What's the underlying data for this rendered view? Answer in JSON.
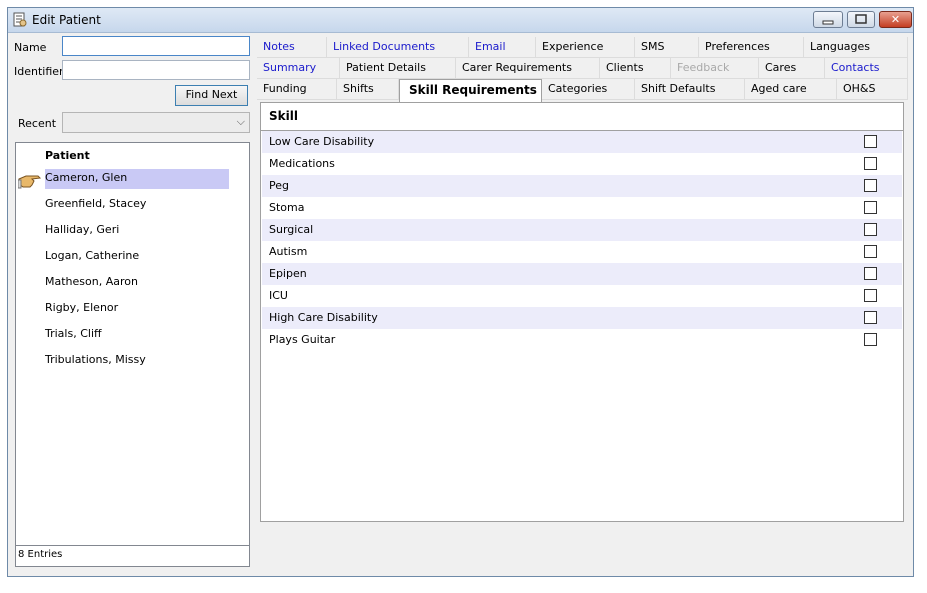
{
  "window": {
    "title": "Edit Patient"
  },
  "search": {
    "name_label": "Name",
    "name_value": "",
    "identifier_label": "Identifier",
    "identifier_value": "",
    "find_next_label": "Find Next",
    "recent_label": "Recent",
    "recent_value": ""
  },
  "patients": {
    "header": "Patient",
    "rows": [
      "Cameron, Glen",
      "Greenfield, Stacey",
      "Halliday, Geri",
      "Logan, Catherine",
      "Matheson, Aaron",
      "Rigby, Elenor",
      "Trials, Cliff",
      "Tribulations, Missy"
    ],
    "selected_index": 0,
    "entries_text": "8 Entries"
  },
  "tabs": {
    "row1": [
      "Notes",
      "Linked Documents",
      "Email",
      "Experience",
      "SMS",
      "Preferences",
      "Languages"
    ],
    "row2": [
      "Summary",
      "Patient Details",
      "Carer Requirements",
      "Clients",
      "Feedback",
      "Cares",
      "Contacts"
    ],
    "row3": [
      "Funding",
      "Shifts",
      "Skill Requirements",
      "Categories",
      "Shift Defaults",
      "Aged care",
      "OH&S"
    ],
    "active": "Skill Requirements"
  },
  "skills": {
    "column_header": "Skill",
    "rows": [
      {
        "name": "Low Care Disability",
        "checked": false
      },
      {
        "name": "Medications",
        "checked": false
      },
      {
        "name": "Peg",
        "checked": false
      },
      {
        "name": "Stoma",
        "checked": false
      },
      {
        "name": "Surgical",
        "checked": false
      },
      {
        "name": "Autism",
        "checked": false
      },
      {
        "name": "Epipen",
        "checked": false
      },
      {
        "name": "ICU",
        "checked": false
      },
      {
        "name": "High Care Disability",
        "checked": false
      },
      {
        "name": "Plays Guitar",
        "checked": false
      }
    ]
  },
  "colors": {
    "link": "#1a1acc",
    "selected_row": "#c9c9f5",
    "alt_row": "#ececfa"
  }
}
